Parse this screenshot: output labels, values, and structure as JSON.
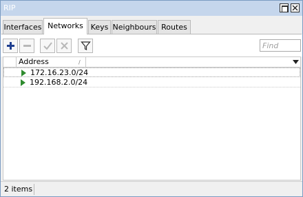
{
  "window": {
    "title": "RIP"
  },
  "tabs": [
    {
      "label": "Interfaces"
    },
    {
      "label": "Networks"
    },
    {
      "label": "Keys"
    },
    {
      "label": "Neighbours"
    },
    {
      "label": "Routes"
    }
  ],
  "active_tab": "Networks",
  "toolbar": {
    "find_placeholder": "Find"
  },
  "table": {
    "columns": [
      {
        "label": "Address"
      }
    ],
    "rows": [
      {
        "address": "172.16.23.0/24"
      },
      {
        "address": "192.168.2.0/24"
      }
    ]
  },
  "status": {
    "text": "2 items"
  },
  "icons": {
    "add": "plus-icon",
    "remove": "minus-icon",
    "enable": "check-icon",
    "disable": "x-icon",
    "filter": "filter-icon",
    "row_status": "play-icon"
  },
  "colors": {
    "titlebar": "#c5d6ec",
    "add_icon": "#1f3f8f",
    "row_icon": "#2e8b2e"
  }
}
